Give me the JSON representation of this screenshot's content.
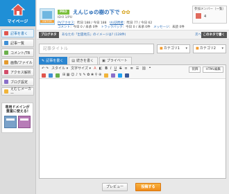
{
  "sidebar": {
    "logo_text": "マイページ",
    "items": [
      {
        "label": "記事を書く",
        "icon": "pencil-icon",
        "color": "#e0564d"
      },
      {
        "label": "記事一覧",
        "icon": "list-icon",
        "color": "#3f8fd6"
      },
      {
        "label": "コメント/TB",
        "icon": "comment-icon",
        "color": "#6ab04c"
      },
      {
        "label": "画像/ファイル",
        "icon": "image-icon",
        "color": "#e39a2d"
      },
      {
        "label": "アクセス解析",
        "icon": "chart-icon",
        "color": "#d24d6a"
      },
      {
        "label": "ブログ設定",
        "icon": "gear-icon",
        "color": "#8a6fc9"
      },
      {
        "label": "えむじメーカー",
        "icon": "smile-icon",
        "color": "#f0b43a"
      }
    ],
    "ad_text_1": "専用ドメインが",
    "ad_text_2": "豊富に使える!"
  },
  "header": {
    "avatar_label": "EDITOR",
    "pro_badge": "PRO",
    "blog_title": "えんじゅの樹の下で",
    "blog_id": "ID:0 1/PU",
    "stats_row1": [
      {
        "text": "PVアクセス",
        "link": true
      },
      {
        "text": "：昨日 188 / 今日 188",
        "link": false
      },
      {
        "text": "UU訪問者",
        "link": true
      },
      {
        "text": "：昨日 77 / 今日 62",
        "link": false
      }
    ],
    "stats_row2": [
      {
        "text": "コメント",
        "link": true
      },
      {
        "text": "：今日 0 / 未承 0件",
        "link": false
      },
      {
        "text": "トラックバック",
        "link": true
      },
      {
        "text": "：今日 0 / 未承 0件",
        "link": false
      },
      {
        "text": "メッセージ",
        "link": true
      },
      {
        "text": "：未読 0件",
        "link": false
      }
    ],
    "member_title": "参加メンバー（一覧）",
    "member_count": "4"
  },
  "topbar": {
    "label": "ブログネタ",
    "text": "あなたの「出雲地方」のイメージは? (128件)",
    "nav": "次へ | 非表",
    "button": "このネタで書く"
  },
  "editor": {
    "title_placeholder": "記事タイトル",
    "category1": "カテゴリ1",
    "category2": "カテゴリ2",
    "tabs": [
      {
        "label": "記事を書く",
        "icon": "pencil-icon"
      },
      {
        "label": "続きを書く",
        "icon": "doc-icon"
      },
      {
        "label": "プライベート",
        "icon": "lock-icon"
      }
    ],
    "toolbar_row1_left": "↶  ↷",
    "font_style": "スタイル",
    "font_size": "文字サイズ",
    "toolbar_right": [
      "装飾",
      "HTML編集"
    ],
    "toolbar_row2": "⊞ ▦ ☺ ♪ ↯ ✎ ✿ ❀ ⚲ ⊕"
  },
  "actions": {
    "preview": "プレビュー",
    "post": "投稿する"
  },
  "colors": {
    "brand": "#1f8fd6",
    "accent_orange": "#f08b1a",
    "link": "#2a6db8",
    "pro_green": "#7cbf3c"
  }
}
